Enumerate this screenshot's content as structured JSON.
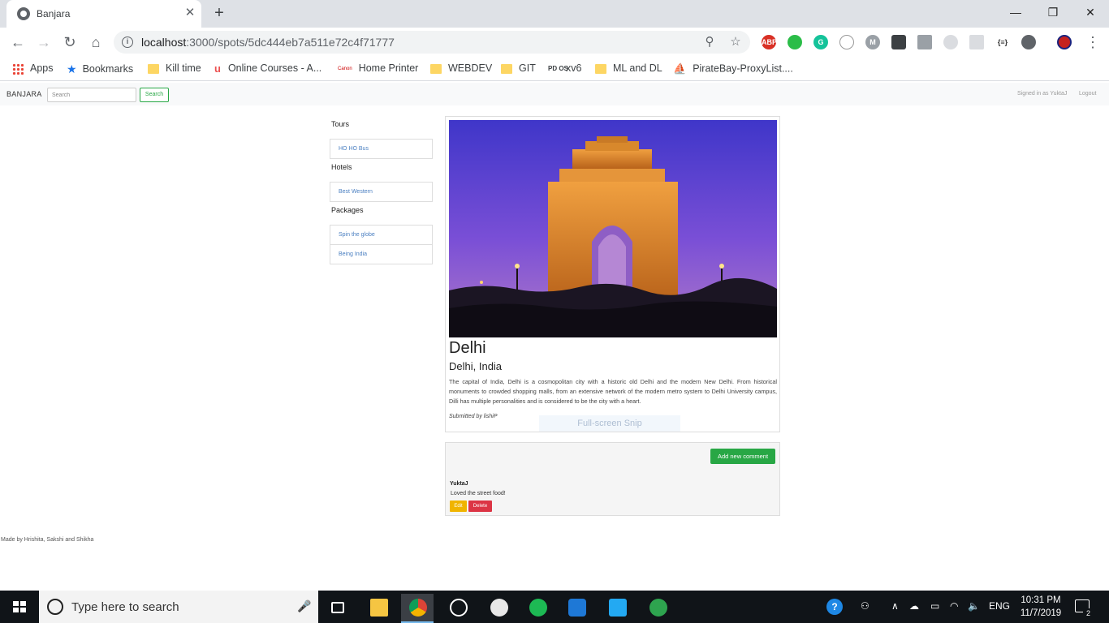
{
  "browser": {
    "tab_title": "Banjara",
    "tab_close": "✕",
    "new_tab": "+",
    "window_minimize": "—",
    "window_restore": "❐",
    "window_close": "✕",
    "url_host": "localhost",
    "url_path": ":3000/spots/5dc444eb7a511e72c4f71777",
    "bookmarks": [
      {
        "label": "Apps",
        "icon": "apps-grid-icon"
      },
      {
        "label": "Bookmarks",
        "icon": "star-icon"
      },
      {
        "label": "Kill time",
        "icon": "folder-icon"
      },
      {
        "label": "Online Courses - A...",
        "icon": "udemy-icon"
      },
      {
        "label": "Home Printer",
        "icon": "canon-icon"
      },
      {
        "label": "WEBDEV",
        "icon": "folder-icon"
      },
      {
        "label": "GIT",
        "icon": "folder-icon"
      },
      {
        "label": "xv6",
        "icon": "pdos-icon"
      },
      {
        "label": "ML and DL",
        "icon": "folder-icon"
      },
      {
        "label": "PirateBay-ProxyList....",
        "icon": "pirate-ship-icon"
      }
    ],
    "extensions": [
      "ABP",
      "",
      "G",
      "",
      "M",
      "",
      "",
      "",
      "",
      "{≡}",
      "",
      ""
    ]
  },
  "app": {
    "brand": "BANJARA",
    "search_placeholder": "Search",
    "search_button": "Search",
    "signed_in": "Signed in as YuktaJ",
    "logout": "Logout",
    "sidebar": {
      "tours_heading": "Tours",
      "tours": [
        "HO HO Bus"
      ],
      "hotels_heading": "Hotels",
      "hotels": [
        "Best Western"
      ],
      "packages_heading": "Packages",
      "packages": [
        "Spin the globe",
        "Being India"
      ]
    },
    "spot": {
      "title": "Delhi",
      "subtitle": "Delhi, India",
      "description": "The capital of India, Delhi is a cosmopolitan city with a historic old Delhi and the modern New Delhi. From historical monuments to crowded shopping malls, from an extensive network of the modern metro system to Delhi University campus, Dilli has multiple personalities and is considered to be the city with a heart.",
      "submitted_by": "Submitted by lishiP"
    },
    "snip_overlay": "Full-screen Snip",
    "comments": {
      "add_button": "Add new comment",
      "items": [
        {
          "author": "YuktaJ",
          "text": "Loved the street food!",
          "edit": "Edit",
          "delete": "Delete"
        }
      ]
    },
    "footer": "Made by Hrishita, Sakshi and Shikha"
  },
  "taskbar": {
    "search_placeholder": "Type here to search",
    "lang": "ENG",
    "time": "10:31 PM",
    "date": "11/7/2019",
    "notification_count": "2"
  }
}
